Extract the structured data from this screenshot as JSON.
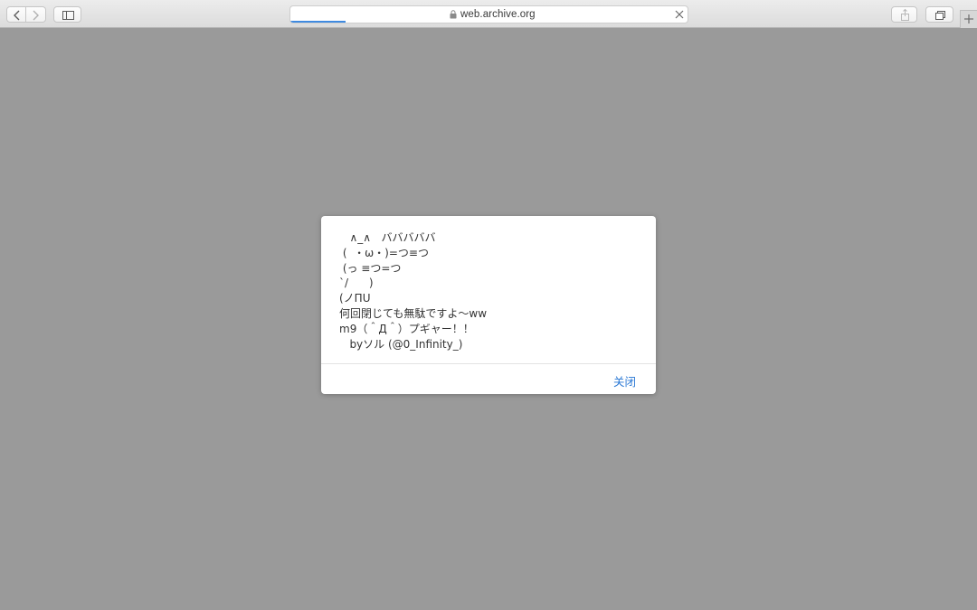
{
  "browser": {
    "address_bar": {
      "url": "web.archive.org",
      "load_progress": 0.14
    },
    "icons": {
      "back": "chevron-left-icon",
      "forward": "chevron-right-icon",
      "sidebar": "sidebar-icon",
      "lock": "lock-icon",
      "stop": "close-icon",
      "share": "share-icon",
      "tabs": "tab-overview-icon",
      "new_tab": "plus-icon"
    }
  },
  "dialog": {
    "message_lines": [
      "   ∧_∧   バババババ",
      " (  ・ω・)=つ≡つ",
      " (っ ≡つ=つ",
      "`/      )",
      "(ノΠU",
      "何回閉じても無駄ですよ～ww",
      "m9（＾Д＾）プギャー！！",
      "   byソル (@0_Infinity_)"
    ],
    "close_label": "关闭"
  },
  "colors": {
    "page_background": "#9a9a9a",
    "link_blue": "#2877d4",
    "progress_blue": "#3f8ae0"
  }
}
